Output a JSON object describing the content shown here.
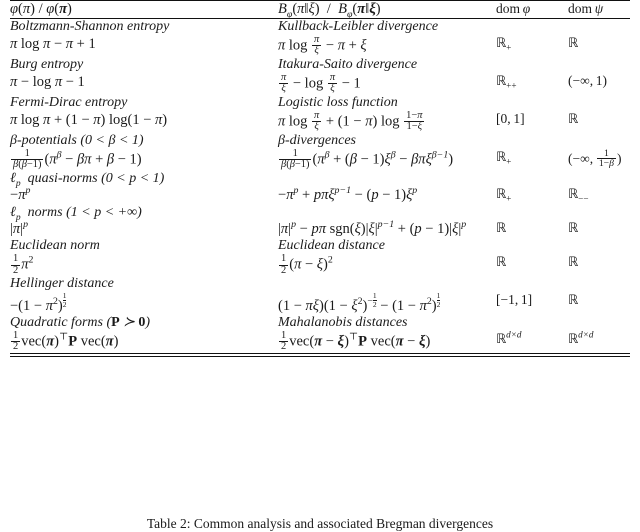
{
  "table": {
    "headers": {
      "generator": "ϕ(π) / ϕ(π)",
      "divergence": "Bϕ(π‖ξ) / Bϕ(π‖ξ)",
      "dom_phi": "dom ϕ",
      "dom_psi": "dom ψ"
    },
    "rows": [
      {
        "generator_name": "Boltzmann-Shannon entropy",
        "generator_formula": "π log π − π + 1",
        "divergence_name": "Kullback-Leibler divergence",
        "divergence_formula": "π log (π/ξ) − π + ξ",
        "dom_phi": "ℝ+",
        "dom_psi": "ℝ"
      },
      {
        "generator_name": "Burg entropy",
        "generator_formula": "π − log π − 1",
        "divergence_name": "Itakura-Saito divergence",
        "divergence_formula": "(π/ξ) − log (π/ξ) − 1",
        "dom_phi": "ℝ++",
        "dom_psi": "(−∞, 1)"
      },
      {
        "generator_name": "Fermi-Dirac entropy",
        "generator_formula": "π log π + (1 − π) log(1 − π)",
        "divergence_name": "Logistic loss function",
        "divergence_formula": "π log (π/ξ) + (1 − π) log ((1−π)/(1−ξ))",
        "dom_phi": "[0, 1]",
        "dom_psi": "ℝ"
      },
      {
        "generator_name": "β-potentials (0 < β < 1)",
        "generator_formula": "1/(β(β−1)) (π^β − βπ + β − 1)",
        "divergence_name": "β-divergences",
        "divergence_formula": "1/(β(β−1)) (π^β + (β − 1)ξ^β − βπξ^(β−1))",
        "dom_phi": "ℝ+",
        "dom_psi": "(−∞, 1/(1−β))"
      },
      {
        "generator_name": "ℓp quasi-norms (0 < p < 1)",
        "generator_formula": "−π^p",
        "divergence_name": "",
        "divergence_formula": "−π^p + pπξ^(p−1) − (p − 1)ξ^p",
        "dom_phi": "ℝ+",
        "dom_psi": "ℝ−−"
      },
      {
        "generator_name": "ℓp norms (1 < p < +∞)",
        "generator_formula": "|π|^p",
        "divergence_name": "",
        "divergence_formula": "|π|^p − pπ sgn(ξ)|ξ|^(p−1) + (p − 1)|ξ|^p",
        "dom_phi": "ℝ",
        "dom_psi": "ℝ"
      },
      {
        "generator_name": "Euclidean norm",
        "generator_formula": "½π²",
        "divergence_name": "Euclidean distance",
        "divergence_formula": "½(π − ξ)²",
        "dom_phi": "ℝ",
        "dom_psi": "ℝ"
      },
      {
        "generator_name": "Hellinger distance",
        "generator_formula": "−(1 − π²)^(1/2)",
        "divergence_name": "",
        "divergence_formula": "(1 − πξ)(1 − ξ²)^(−1/2) − (1 − π²)^(1/2)",
        "dom_phi": "[−1, 1]",
        "dom_psi": "ℝ"
      },
      {
        "generator_name": "Quadratic forms (P ≻ 0)",
        "generator_formula": "½vec(π)ᵀ P vec(π)",
        "divergence_name": "Mahalanobis distances",
        "divergence_formula": "½vec(π − ξ)ᵀ P vec(π − ξ)",
        "dom_phi": "ℝ^(d×d)",
        "dom_psi": "ℝ^(d×d)"
      }
    ]
  },
  "caption": {
    "label": "Table 2:",
    "text": "Common analysis and associated Bregman divergences"
  }
}
